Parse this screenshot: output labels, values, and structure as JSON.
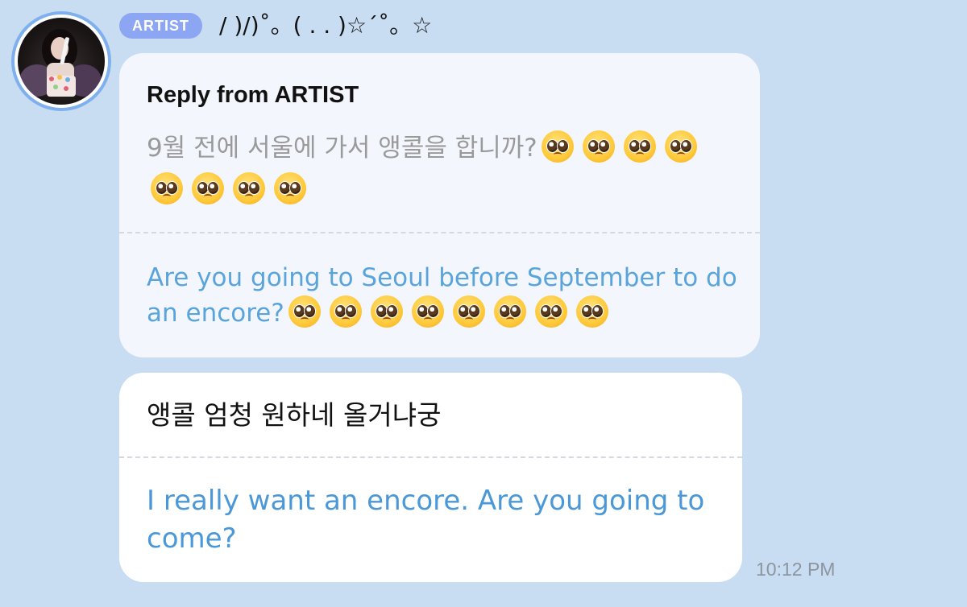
{
  "sender": {
    "badge": "ARTIST",
    "name": "/ )/)˚。( . . )☆´˚。☆",
    "avatar_icon": "artist-avatar-photo"
  },
  "reply": {
    "title": "Reply from ARTIST",
    "original_text": "9월 전에 서울에 가서 앵콜을 합니까?",
    "original_emoji_count": 8,
    "translation_text": "Are you going to Seoul before September to do an encore?",
    "translation_emoji_count": 8,
    "emoji_icon": "pleading-face-emoji"
  },
  "message": {
    "original_text": "앵콜 엄청 원하네 올거냐궁",
    "translation_text": "I really want an encore. Are you going to come?",
    "timestamp": "10:12 PM"
  },
  "colors": {
    "background": "#c8dcf2",
    "badge": "#8ca6f3",
    "avatar_ring": "#7fb0ee",
    "translation_text": "#5aa4dc",
    "original_text_muted": "#9a9a9a"
  }
}
